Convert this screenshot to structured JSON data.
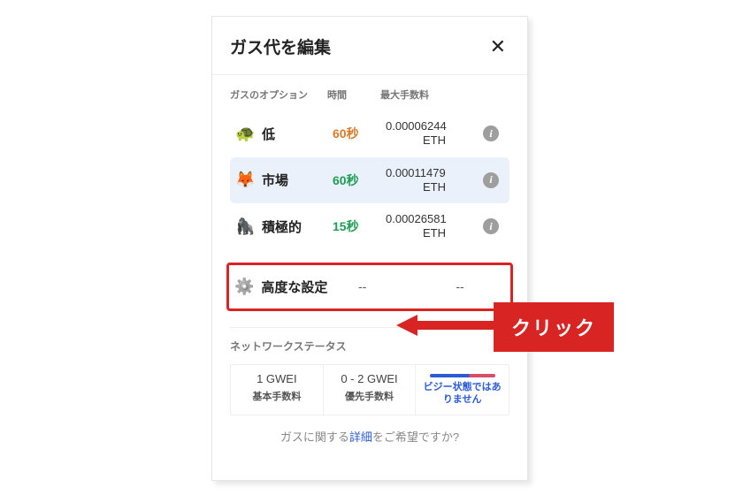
{
  "annotation": {
    "click_label": "クリック"
  },
  "header": {
    "title": "ガス代を編集"
  },
  "columns": {
    "option": "ガスのオプション",
    "time": "時間",
    "maxfee": "最大手数料"
  },
  "options": [
    {
      "icon": "🐢",
      "label": "低",
      "time": "60秒",
      "time_color": "orange",
      "fee": "0.00006244",
      "unit": "ETH",
      "selected": false
    },
    {
      "icon": "🦊",
      "label": "市場",
      "time": "60秒",
      "time_color": "green",
      "fee": "0.00011479",
      "unit": "ETH",
      "selected": true
    },
    {
      "icon": "🦍",
      "label": "積極的",
      "time": "15秒",
      "time_color": "green",
      "fee": "0.00026581",
      "unit": "ETH",
      "selected": false
    }
  ],
  "advanced": {
    "icon": "⚙️",
    "label": "高度な設定",
    "time": "--",
    "fee": "--"
  },
  "network": {
    "heading": "ネットワークステータス",
    "base_fee": {
      "value": "1 GWEI",
      "label": "基本手数料"
    },
    "priority_fee": {
      "value": "0 - 2 GWEI",
      "label": "優先手数料"
    },
    "busy": {
      "text": "ビジー状態ではありません"
    }
  },
  "footer": {
    "prefix": "ガスに関する",
    "link": "詳細",
    "suffix": "をご希望ですか?"
  }
}
